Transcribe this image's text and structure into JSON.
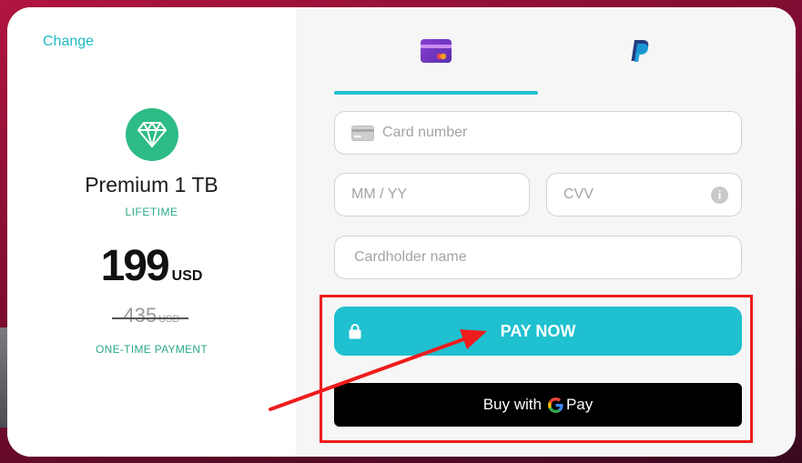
{
  "left_panel": {
    "change_link": "Change",
    "gem_icon": "diamond-icon",
    "plan_name": "Premium 1 TB",
    "plan_term": "LIFETIME",
    "price_value": "199",
    "price_currency": "USD",
    "old_price_value": "435",
    "old_price_currency": "USD",
    "payment_type": "ONE-TIME PAYMENT"
  },
  "tabs": {
    "card_icon": "credit-card-icon",
    "paypal_icon": "paypal-icon"
  },
  "form": {
    "card_number_placeholder": "Card number",
    "expiry_placeholder": "MM / YY",
    "cvv_placeholder": "CVV",
    "cardholder_placeholder": "Cardholder name"
  },
  "actions": {
    "pay_now_label": "PAY NOW",
    "gpay_prefix": "Buy with",
    "gpay_brand": "Pay"
  },
  "colors": {
    "accent": "#1fc0cf",
    "green": "#2aa888",
    "annotation_red": "#ee1c1c"
  }
}
